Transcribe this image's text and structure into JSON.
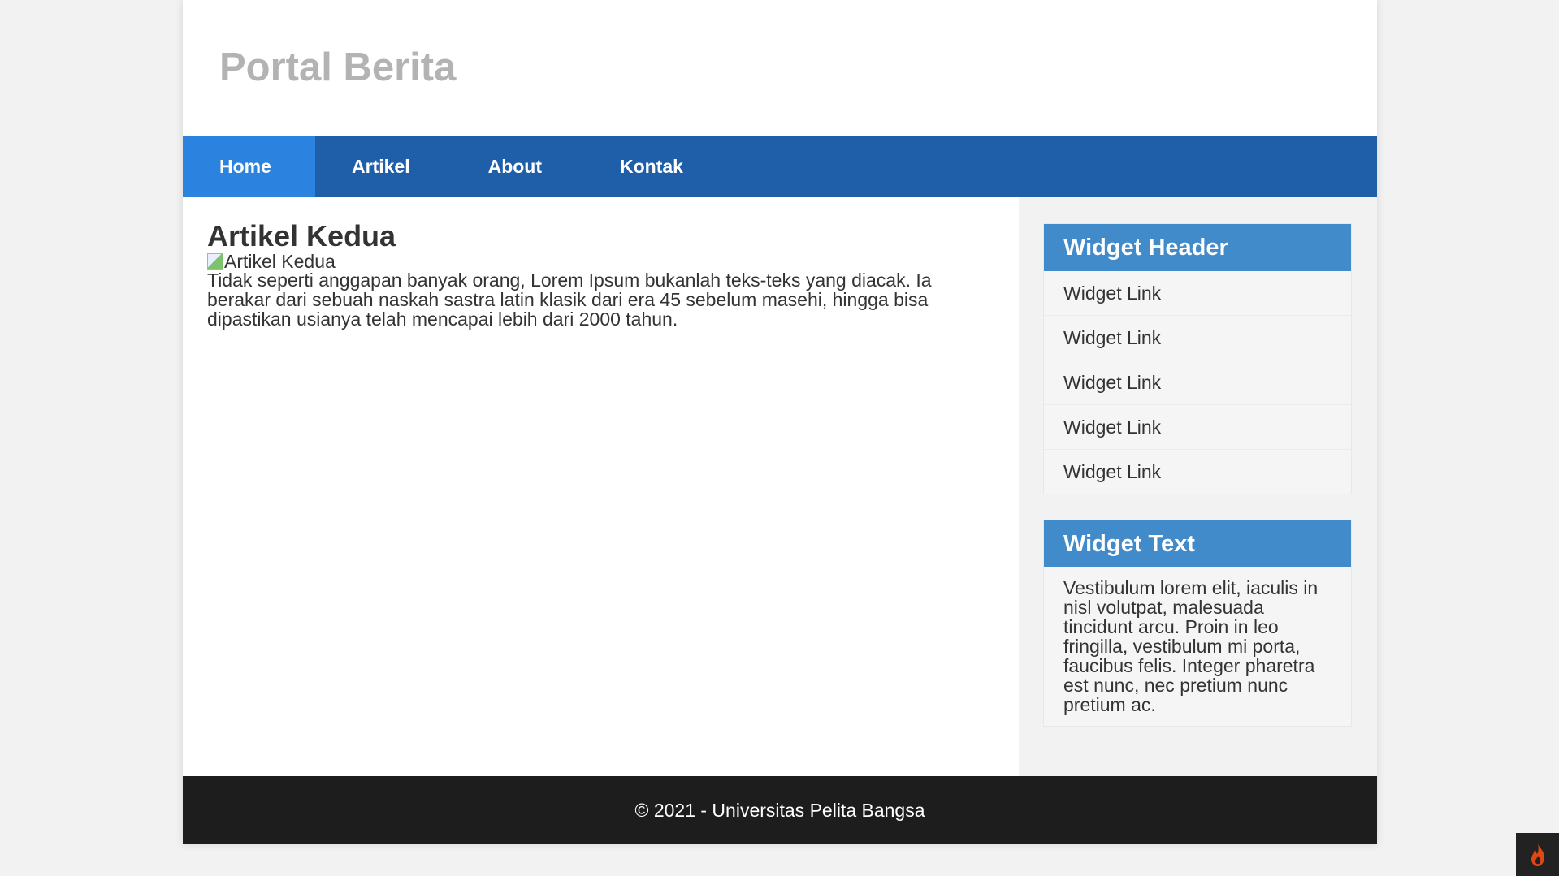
{
  "site": {
    "title": "Portal Berita"
  },
  "nav": {
    "items": [
      {
        "label": "Home",
        "active": true
      },
      {
        "label": "Artikel",
        "active": false
      },
      {
        "label": "About",
        "active": false
      },
      {
        "label": "Kontak",
        "active": false
      }
    ]
  },
  "article": {
    "title": "Artikel Kedua",
    "image_alt": "Artikel Kedua",
    "body": "Tidak seperti anggapan banyak orang, Lorem Ipsum bukanlah teks-teks yang diacak. Ia berakar dari sebuah naskah sastra latin klasik dari era 45 sebelum masehi, hingga bisa dipastikan usianya telah mencapai lebih dari 2000 tahun."
  },
  "sidebar": {
    "links_widget": {
      "header": "Widget Header",
      "links": [
        "Widget Link",
        "Widget Link",
        "Widget Link",
        "Widget Link",
        "Widget Link"
      ]
    },
    "text_widget": {
      "header": "Widget Text",
      "text": "Vestibulum lorem elit, iaculis in nisl volutpat, malesuada tincidunt arcu. Proin in leo fringilla, vestibulum mi porta, faucibus felis. Integer pharetra est nunc, nec pretium nunc pretium ac."
    }
  },
  "footer": {
    "text": "© 2021 - Universitas Pelita Bangsa"
  },
  "debug_toolbar": {
    "icon": "flame-icon"
  },
  "colors": {
    "nav_bg": "#1f5faa",
    "nav_active": "#2b83df",
    "widget_header": "#428bcb",
    "footer_bg": "#1d1d1d",
    "site_title": "#b3b3b3"
  }
}
